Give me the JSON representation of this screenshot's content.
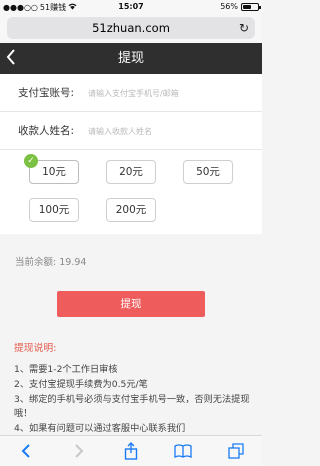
{
  "status_bar": {
    "carrier": "51赚钱",
    "time": "15:07",
    "battery_percent": "56%",
    "battery_level": 0.56
  },
  "browser": {
    "url": "51zhuan.com"
  },
  "header": {
    "title": "提现"
  },
  "form": {
    "alipay_label": "支付宝账号:",
    "alipay_placeholder": "请输入支付宝手机号/邮箱",
    "name_label": "收款人姓名:",
    "name_placeholder": "请输入收款人姓名"
  },
  "amounts": {
    "options": [
      "10元",
      "20元",
      "50元",
      "100元",
      "200元"
    ],
    "selected": "10元"
  },
  "balance": {
    "label": "当前余额:",
    "value": "19.94"
  },
  "submit_label": "提现",
  "notes": {
    "title": "提现说明:",
    "items": [
      "1、需要1-2个工作日审核",
      "2、支付宝提现手续费为0.5元/笔",
      "3、绑定的手机号必须与支付宝手机号一致，否则无法提现哦！",
      "4、如果有问题可以通过客服中心联系我们"
    ]
  },
  "colors": {
    "accent": "#ef5c5c",
    "header_bg": "#2f2f2f",
    "notes_title": "#e55b4d",
    "check": "#7cc143",
    "ios_blue": "#1a7cf4"
  }
}
